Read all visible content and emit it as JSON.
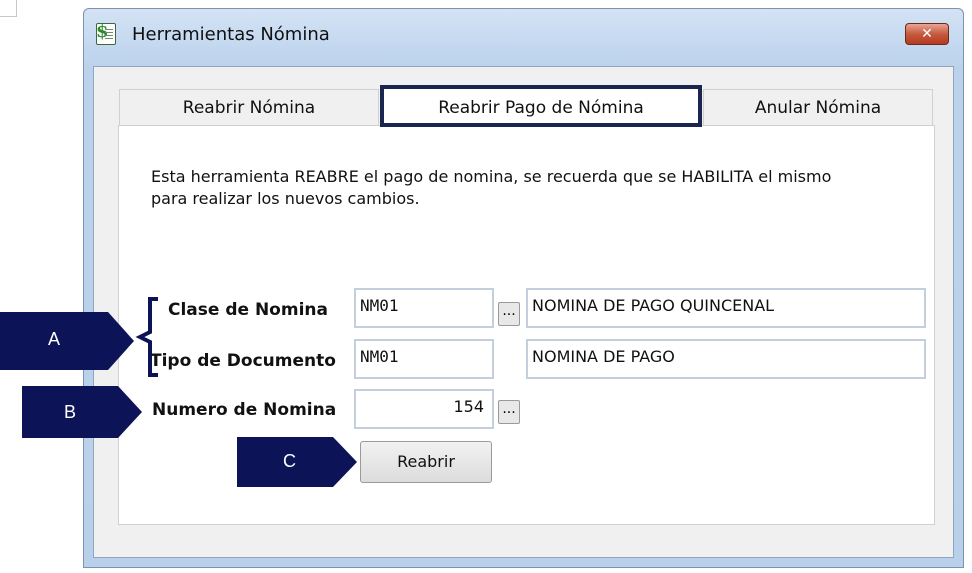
{
  "window": {
    "title": "Herramientas Nómina",
    "close_label": "✕",
    "tabs": [
      {
        "label": "Reabrir Nómina",
        "selected": false
      },
      {
        "label": "Reabrir Pago de Nómina",
        "selected": true
      },
      {
        "label": "Anular Nómina",
        "selected": false
      }
    ]
  },
  "panel": {
    "description": "Esta herramienta REABRE el pago de nomina, se recuerda que se HABILITA el mismo para realizar los nuevos cambios.",
    "clase": {
      "label": "Clase de Nomina",
      "code": "NM01",
      "browse_label": "...",
      "description": "NOMINA DE PAGO QUINCENAL"
    },
    "tipo": {
      "label": "Tipo de Documento",
      "code": "NM01",
      "description": "NOMINA DE PAGO"
    },
    "numero": {
      "label": "Numero de Nomina",
      "value": "154",
      "browse_label": "..."
    },
    "reabrir_label": "Reabrir"
  },
  "callouts": {
    "a": "A",
    "b": "B",
    "c": "C",
    "color": "#0c1457"
  }
}
